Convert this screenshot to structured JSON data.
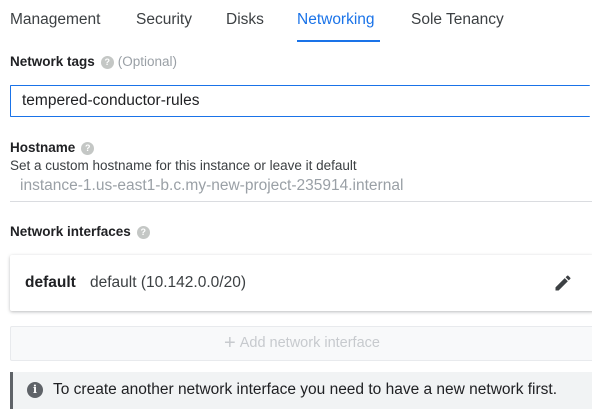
{
  "tabs": [
    {
      "label": "Management"
    },
    {
      "label": "Security"
    },
    {
      "label": "Disks"
    },
    {
      "label": "Networking",
      "active": true
    },
    {
      "label": "Sole Tenancy"
    }
  ],
  "network_tags": {
    "label": "Network tags",
    "help_icon": "help-circle-icon",
    "optional": "(Optional)",
    "value": "tempered-conductor-rules"
  },
  "hostname": {
    "label": "Hostname",
    "help_icon": "help-circle-icon",
    "hint": "Set a custom hostname for this instance or leave it default",
    "placeholder": "instance-1.us-east1-b.c.my-new-project-235914.internal"
  },
  "network_interfaces": {
    "label": "Network interfaces",
    "help_icon": "help-circle-icon",
    "items": [
      {
        "name": "default",
        "detail": "default (10.142.0.0/20)",
        "action_icon": "pencil-edit-icon"
      }
    ],
    "add_button": {
      "icon": "plus-icon",
      "label": "Add network interface"
    }
  },
  "info": {
    "icon": "info-circle-icon",
    "text": "To create another network interface you need to have a new network first."
  },
  "colors": {
    "accent": "#1a73e8",
    "text": "#202124",
    "muted": "#9aa0a6",
    "info_bg": "#f1f3f4"
  }
}
